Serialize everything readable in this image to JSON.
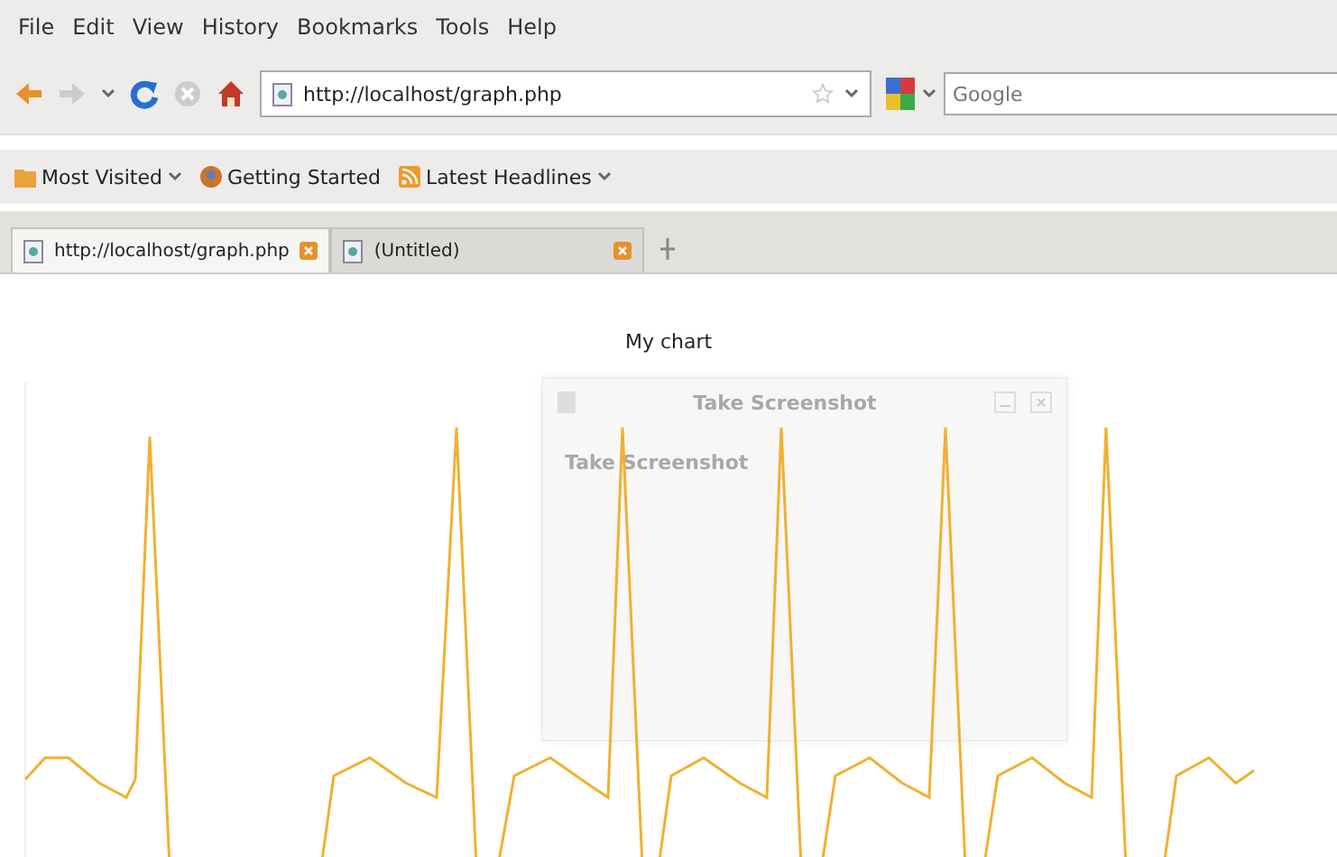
{
  "menu_bar": {
    "items": [
      "File",
      "Edit",
      "View",
      "History",
      "Bookmarks",
      "Tools",
      "Help"
    ]
  },
  "navigation": {
    "url": "http://localhost/graph.php",
    "search": {
      "placeholder": "Google"
    }
  },
  "bookmarks": [
    {
      "label": "Most Visited",
      "dropdown": true,
      "kind": "folder"
    },
    {
      "label": "Getting Started",
      "dropdown": false,
      "kind": "page"
    },
    {
      "label": "Latest Headlines",
      "dropdown": true,
      "kind": "feed"
    }
  ],
  "tabs": [
    {
      "label": "http://localhost/graph.php",
      "selected": true
    },
    {
      "label": "(Untitled)",
      "selected": false
    }
  ],
  "page": {
    "chart_title": "My chart"
  },
  "dialog": {
    "title": "Take Screenshot",
    "heading": "Take Screenshot"
  }
}
